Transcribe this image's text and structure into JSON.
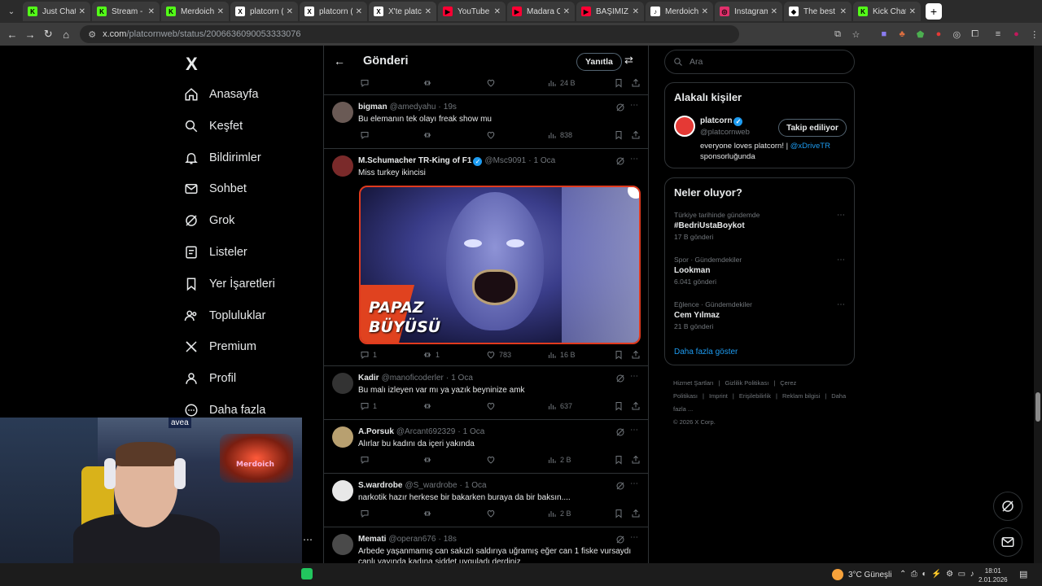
{
  "browser": {
    "tabs": [
      {
        "title": "Just Chatti",
        "fav_color": "#53fc18",
        "fav_text": "K"
      },
      {
        "title": "Stream - K",
        "fav_color": "#53fc18",
        "fav_text": "K"
      },
      {
        "title": "Merdoichi",
        "fav_color": "#53fc18",
        "fav_text": "K"
      },
      {
        "title": "platcorn (@",
        "fav_color": "#ffffff",
        "fav_text": "X"
      },
      {
        "title": "platcorn (@",
        "fav_color": "#ffffff",
        "fav_text": "X"
      },
      {
        "title": "X'te platc",
        "fav_color": "#ffffff",
        "fav_text": "X"
      },
      {
        "title": "YouTube",
        "fav_color": "#ff0033",
        "fav_text": "▶"
      },
      {
        "title": "Madara O",
        "fav_color": "#ff0033",
        "fav_text": "▶"
      },
      {
        "title": "BAŞIMIZ S",
        "fav_color": "#ff0033",
        "fav_text": "▶"
      },
      {
        "title": "Merdoich",
        "fav_color": "#ffffff",
        "fav_text": "♪"
      },
      {
        "title": "Instagram",
        "fav_color": "#e1306c",
        "fav_text": "◎"
      },
      {
        "title": "The best (",
        "fav_color": "#ffffff",
        "fav_text": "◆"
      },
      {
        "title": "Kick Chat",
        "fav_color": "#53fc18",
        "fav_text": "K"
      }
    ],
    "url_host": "x.com",
    "url_path": "/platcornweb/status/2006636090053333076"
  },
  "nav": {
    "logo": "X",
    "items": [
      {
        "label": "Anasayfa",
        "icon": "home-icon"
      },
      {
        "label": "Keşfet",
        "icon": "search-icon"
      },
      {
        "label": "Bildirimler",
        "icon": "bell-icon"
      },
      {
        "label": "Sohbet",
        "icon": "mail-icon"
      },
      {
        "label": "Grok",
        "icon": "grok-icon"
      },
      {
        "label": "Listeler",
        "icon": "list-icon"
      },
      {
        "label": "Yer İşaretleri",
        "icon": "bookmark-icon"
      },
      {
        "label": "Topluluklar",
        "icon": "people-icon"
      },
      {
        "label": "Premium",
        "icon": "x-icon"
      },
      {
        "label": "Profil",
        "icon": "person-icon"
      },
      {
        "label": "Daha fazla",
        "icon": "more-circle-icon"
      }
    ]
  },
  "timeline": {
    "header_title": "Gönderi",
    "reply_label": "Yanıtla",
    "first_actions": {
      "views": "24 B"
    },
    "tweets": [
      {
        "name": "bigman",
        "handle": "@amedyahu",
        "time": "19s",
        "text": "Bu elemanın tek olayı freak show mu",
        "replies": "",
        "retweets": "",
        "likes": "",
        "views": "838",
        "verified": false,
        "avatar": "#6a5a55"
      },
      {
        "name": "M.Schumacher TR-King of F1",
        "handle": "@Msc9091",
        "time": "1 Oca",
        "text": "Miss turkey ikincisi",
        "replies": "1",
        "retweets": "1",
        "likes": "783",
        "views": "16 B",
        "verified": true,
        "avatar": "#7a2a2a",
        "media_caption_1": "PAPAZ",
        "media_caption_2": "BÜYÜSÜ"
      },
      {
        "name": "Kadir",
        "handle": "@manoficoderler",
        "time": "1 Oca",
        "text": "Bu malı izleyen var mı ya yazık beyninize amk",
        "replies": "1",
        "retweets": "",
        "likes": "",
        "views": "637",
        "verified": false,
        "avatar": "#333333"
      },
      {
        "name": "A.Porsuk",
        "handle": "@Arcant692329",
        "time": "1 Oca",
        "text": "Alırlar bu kadını da içeri yakında",
        "replies": "",
        "retweets": "",
        "likes": "",
        "views": "2 B",
        "verified": false,
        "avatar": "#b8a070"
      },
      {
        "name": "S.wardrobe",
        "handle": "@S_wardrobe",
        "time": "1 Oca",
        "text": "narkotik hazır herkese bir bakarken buraya da bir baksın....",
        "replies": "",
        "retweets": "",
        "likes": "",
        "views": "2 B",
        "verified": false,
        "avatar": "#e8e8e8"
      },
      {
        "name": "Memati",
        "handle": "@operan676",
        "time": "18s",
        "text": "Arbede yaşanmamış can sakızlı saldırıya uğramış eğer can 1 fiske vursaydı canlı yayında kadına şiddet uyguladı derdiniz",
        "replies": "",
        "retweets": "",
        "likes": "",
        "views": "",
        "verified": false,
        "avatar": "#4a4a4a"
      }
    ]
  },
  "right": {
    "search_placeholder": "Ara",
    "related_title": "Alakalı kişiler",
    "related_user": {
      "name": "platcorn",
      "handle": "@platcornweb",
      "bio_1": "everyone loves platcorn! |",
      "bio_link": "@xDriveTR",
      "bio_2": "sponsorluğunda",
      "follow_label": "Takip ediliyor"
    },
    "trends_title": "Neler oluyor?",
    "trends": [
      {
        "context": "Türkiye tarihinde gündemde",
        "name": "#BedriUstaBoykot",
        "count": "17 B gönderi"
      },
      {
        "context": "Spor · Gündemdekiler",
        "name": "Lookman",
        "count": "6.041 gönderi"
      },
      {
        "context": "Eğlence · Gündemdekiler",
        "name": "Cem Yılmaz",
        "count": "21 B gönderi"
      }
    ],
    "show_more": "Daha fazla göster",
    "footer": [
      "Hizmet Şartları",
      "|",
      "Gizlilik Politikası",
      "|",
      "Çerez Politikası",
      "|",
      "Imprint",
      "|",
      "Erişilebilirlik",
      "|",
      "Reklam bilgisi",
      "|",
      "Daha fazla ...",
      "© 2026 X Corp."
    ]
  },
  "webcam": {
    "brand_text": "avea",
    "neon_text": "Merdoich"
  },
  "taskbar": {
    "weather": "3°C  Güneşli",
    "time": "18:01",
    "date": "2.01.2026"
  },
  "colors": {
    "accent": "#1d9bf0",
    "border": "#2f3336",
    "muted": "#71767b"
  }
}
